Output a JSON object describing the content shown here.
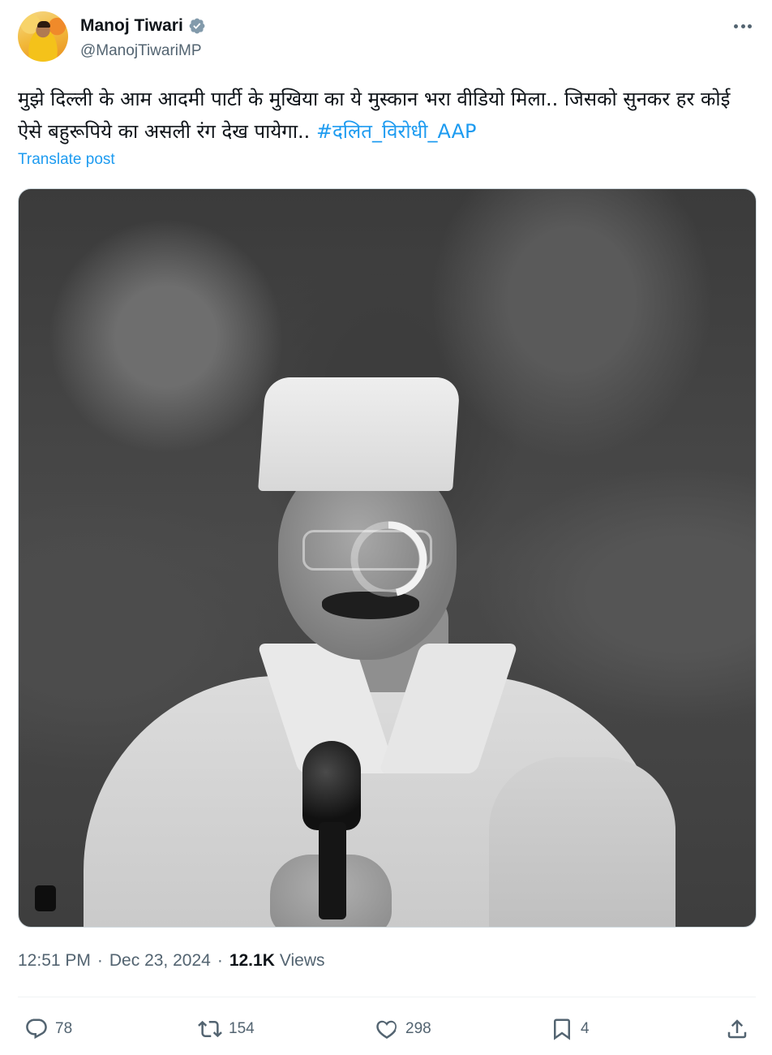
{
  "author": {
    "display_name": "Manoj Tiwari",
    "handle": "@ManojTiwariMP",
    "verified": true
  },
  "icons": {
    "more": "more-horizontal-icon",
    "verified": "verified-badge-icon",
    "reply": "reply-icon",
    "repost": "repost-icon",
    "like": "heart-icon",
    "bookmark": "bookmark-icon",
    "share": "share-icon",
    "loading": "loading-spinner-icon"
  },
  "post": {
    "text": "मुझे दिल्ली के आम आदमी पार्टी के मुखिया का ये मुस्कान भरा वीडियो मिला.. जिसको सुनकर हर कोई ऐसे बहुरूपिये का असली रंग देख पायेगा..",
    "hashtag": "#दलित_विरोधी_AAP",
    "translate_label": "Translate post",
    "time": "12:51 PM",
    "date": "Dec 23, 2024",
    "separator": "·",
    "views_count": "12.1K",
    "views_label": "Views"
  },
  "stats": {
    "replies": "78",
    "reposts": "154",
    "likes": "298",
    "bookmarks": "4"
  },
  "colors": {
    "accent": "#1d9bf0",
    "text": "#0f1419",
    "secondary": "#536471",
    "border": "#eff3f4"
  }
}
